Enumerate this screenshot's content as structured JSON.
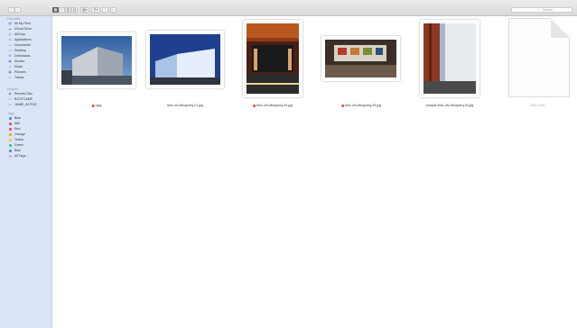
{
  "toolbar": {
    "buttons": [
      {
        "name": "back-button",
        "icon": "‹"
      },
      {
        "name": "forward-button",
        "icon": "›"
      },
      {
        "name": "icon-view-button",
        "icon": "▦"
      },
      {
        "name": "list-view-button",
        "icon": "≡"
      },
      {
        "name": "column-view-button",
        "icon": "▥"
      },
      {
        "name": "gallery-view-button",
        "icon": "▤"
      },
      {
        "name": "arrange-button",
        "icon": "▦▾"
      },
      {
        "name": "action-button",
        "icon": "⚙▾"
      },
      {
        "name": "share-button",
        "icon": "↑"
      },
      {
        "name": "tags-button",
        "icon": "○"
      }
    ],
    "search_placeholder": "Search",
    "search_icon": "⌕"
  },
  "sidebar": {
    "favorites_header": "Favorites",
    "favorites": [
      {
        "label": "All My Files",
        "icon": "▤"
      },
      {
        "label": "iCloud Drive",
        "icon": "☁"
      },
      {
        "label": "AirDrop",
        "icon": "◎"
      },
      {
        "label": "Applications",
        "icon": "A"
      },
      {
        "label": "Documents",
        "icon": "▭"
      },
      {
        "label": "Desktop",
        "icon": "▭"
      },
      {
        "label": "Downloads",
        "icon": "⊕"
      },
      {
        "label": "Movies",
        "icon": "▣"
      },
      {
        "label": "Music",
        "icon": "♫"
      },
      {
        "label": "Pictures",
        "icon": "▣"
      },
      {
        "label": "Tracks",
        "icon": "▭"
      }
    ],
    "devices_header": "Devices",
    "devices": [
      {
        "label": "Remote Disc",
        "icon": "◉"
      },
      {
        "label": "BOOTCAMP",
        "icon": "▭"
      },
      {
        "label": "JAMIE_ACTIVE",
        "icon": "▭",
        "eject": "⏏"
      }
    ],
    "tags_header": "Tags",
    "tags": [
      {
        "label": "Blue",
        "color": "#3b82f6"
      },
      {
        "label": "Will",
        "color": "#e2474a"
      },
      {
        "label": "Red",
        "color": "#e2474a"
      },
      {
        "label": "Orange",
        "color": "#f59e0b"
      },
      {
        "label": "Yellow",
        "color": "#facc15"
      },
      {
        "label": "Green",
        "color": "#22c55e"
      },
      {
        "label": "Blue",
        "color": "#3b82f6"
      },
      {
        "label": "All Tags...",
        "color": "#b8b8b8"
      }
    ]
  },
  "files": [
    {
      "name": "I.jpg",
      "tag": "red"
    },
    {
      "name": "MoL-uN-vlbuquerq-01.jpg",
      "tag": ""
    },
    {
      "name": "MoL-uN-vlbuquerq-04.jpg",
      "tag": "red"
    },
    {
      "name": "MoL-uN-vlbuquerq-03.jpg",
      "tag": "red"
    },
    {
      "name": "portada-MoL-uN-vlbuquerq-02.jpg",
      "tag": ""
    },
    {
      "name": "IMG_Exai...",
      "tag": ""
    }
  ]
}
